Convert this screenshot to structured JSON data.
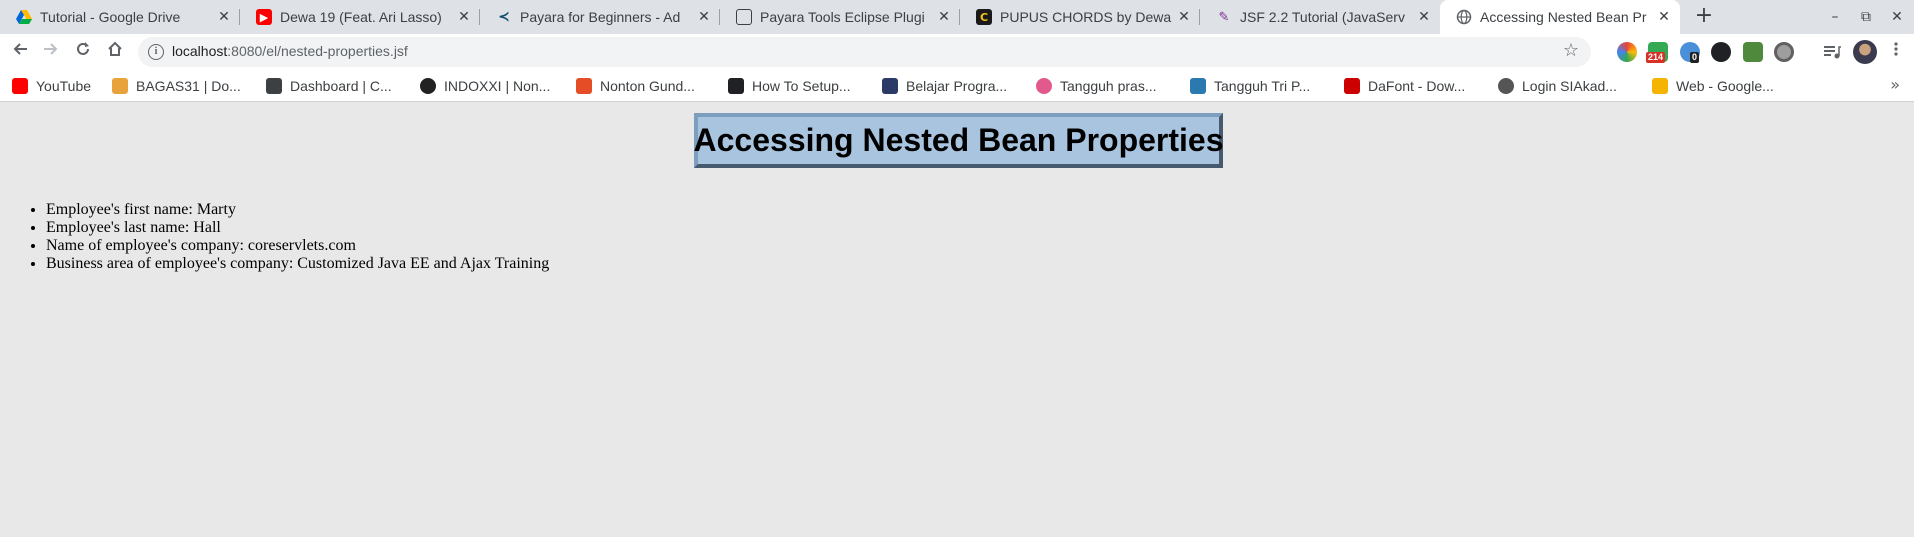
{
  "tabs": [
    {
      "title": "Tutorial - Google Drive",
      "icon": "google-drive-icon",
      "color": "#1fa463"
    },
    {
      "title": "Dewa 19 (Feat. Ari Lasso)",
      "icon": "youtube-icon",
      "color": "#ff0000"
    },
    {
      "title": "Payara for Beginners - Ad",
      "icon": "payara-icon",
      "color": "#0c4a6e"
    },
    {
      "title": "Payara Tools Eclipse Plugi",
      "icon": "book-icon",
      "color": "#3c4043"
    },
    {
      "title": "PUPUS CHORDS by Dewa",
      "icon": "chords-icon",
      "color": "#1a1a1a"
    },
    {
      "title": "JSF 2.2 Tutorial (JavaServ",
      "icon": "jsf-icon",
      "color": "#7b2c8f"
    },
    {
      "title": "Accessing Nested Bean Pr",
      "icon": "globe-icon",
      "color": "#5f6368"
    }
  ],
  "window_controls": {
    "minimize": "–",
    "restore": "⧉",
    "close": "✕"
  },
  "address_bar": {
    "host": "localhost",
    "path": ":8080/el/nested-properties.jsf"
  },
  "extensions": {
    "badge_count": "214",
    "badge_zero": "0"
  },
  "bookmarks": [
    {
      "label": "YouTube",
      "color": "#ff0000"
    },
    {
      "label": "BAGAS31 | Do...",
      "color": "#e8a33d"
    },
    {
      "label": "Dashboard | C...",
      "color": "#3c4043"
    },
    {
      "label": "INDOXXI | Non...",
      "color": "#222222"
    },
    {
      "label": "Nonton Gund...",
      "color": "#e44d26"
    },
    {
      "label": "How To Setup...",
      "color": "#202124"
    },
    {
      "label": "Belajar Progra...",
      "color": "#2b3a67"
    },
    {
      "label": "Tangguh pras...",
      "color": "#e25a8d"
    },
    {
      "label": "Tangguh Tri P...",
      "color": "#2a7ab0"
    },
    {
      "label": "DaFont - Dow...",
      "color": "#cc0000"
    },
    {
      "label": "Login SIAkad...",
      "color": "#555555"
    },
    {
      "label": "Web - Google...",
      "color": "#f4b400"
    }
  ],
  "page": {
    "heading": "Accessing Nested Bean Properties",
    "items": [
      "Employee's first name: Marty",
      "Employee's last name: Hall",
      "Name of employee's company: coreservlets.com",
      "Business area of employee's company: Customized Java EE and Ajax Training"
    ]
  }
}
